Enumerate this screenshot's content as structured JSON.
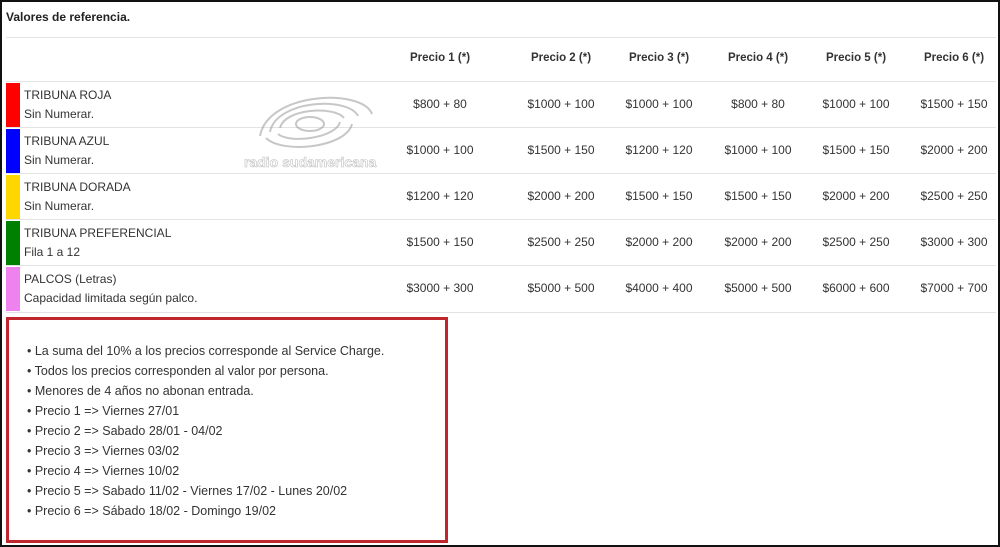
{
  "page": {
    "title": "Valores de referencia."
  },
  "columns": [
    "Precio 1 (*)",
    "Precio 2 (*)",
    "Precio 3 (*)",
    "Precio 4 (*)",
    "Precio 5 (*)",
    "Precio 6 (*)"
  ],
  "rows": [
    {
      "name": "TRIBUNA ROJA",
      "sub": "Sin Numerar.",
      "color": "#ff0000",
      "prices": [
        "$800 + 80",
        "$1000 + 100",
        "$1000 + 100",
        "$800 + 80",
        "$1000 + 100",
        "$1500 + 150"
      ]
    },
    {
      "name": "TRIBUNA AZUL",
      "sub": "Sin Numerar.",
      "color": "#0000ff",
      "prices": [
        "$1000 + 100",
        "$1500 + 150",
        "$1200 + 120",
        "$1000 + 100",
        "$1500 + 150",
        "$2000 + 200"
      ]
    },
    {
      "name": "TRIBUNA DORADA",
      "sub": "Sin Numerar.",
      "color": "#ffd700",
      "prices": [
        "$1200 + 120",
        "$2000 + 200",
        "$1500 + 150",
        "$1500 + 150",
        "$2000 + 200",
        "$2500 + 250"
      ]
    },
    {
      "name": "TRIBUNA PREFERENCIAL",
      "sub": "Fila 1 a 12",
      "color": "#008000",
      "prices": [
        "$1500 + 150",
        "$2500 + 250",
        "$2000 + 200",
        "$2000 + 200",
        "$2500 + 250",
        "$3000 + 300"
      ]
    },
    {
      "name": "PALCOS (Letras)",
      "sub": "Capacidad limitada según palco.",
      "color": "#ee82ee",
      "prices": [
        "$3000 + 300",
        "$5000 + 500",
        "$4000 + 400",
        "$5000 + 500",
        "$6000 + 600",
        "$7000 + 700"
      ]
    }
  ],
  "watermark": {
    "text": "radio sudamericana",
    "icon": "radio-waves-logo"
  },
  "notes": [
    "• La suma del 10% a los precios corresponde al Service Charge.",
    "• Todos los precios corresponden al valor por persona.",
    "• Menores de 4 años no abonan entrada.",
    "• Precio 1 => Viernes 27/01",
    "• Precio 2 => Sabado 28/01 - 04/02",
    "• Precio 3 => Viernes 03/02",
    "• Precio 4 => Viernes 10/02",
    "• Precio 5 => Sabado 11/02 - Viernes 17/02 - Lunes 20/02",
    "• Precio 6 => Sábado 18/02 - Domingo 19/02"
  ],
  "colors": {
    "notes_border": "#c0262d",
    "grid": "#e3e3e3"
  }
}
